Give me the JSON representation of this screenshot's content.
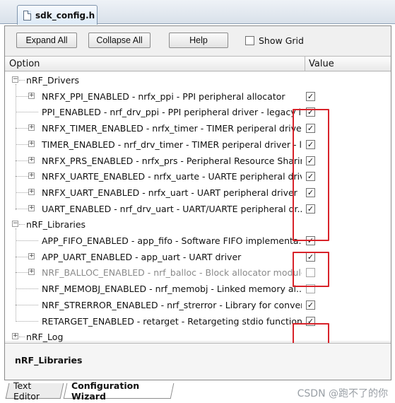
{
  "file_tab": {
    "label": "sdk_config.h"
  },
  "toolbar": {
    "expand_all": "Expand All",
    "collapse_all": "Collapse All",
    "help": "Help",
    "show_grid": "Show Grid",
    "show_grid_checked": false
  },
  "columns": {
    "option": "Option",
    "value": "Value"
  },
  "tree": {
    "groups": [
      {
        "label": "nRF_Drivers",
        "expanded": true,
        "items": [
          {
            "label": "NRFX_PPI_ENABLED - nrfx_ppi - PPI peripheral allocator",
            "has_children": true,
            "checked": true
          },
          {
            "label": "PPI_ENABLED  - nrf_drv_ppi - PPI peripheral driver - legacy l...",
            "has_children": false,
            "checked": true
          },
          {
            "label": "NRFX_TIMER_ENABLED - nrfx_timer - TIMER periperal driver",
            "has_children": true,
            "checked": true
          },
          {
            "label": "TIMER_ENABLED - nrf_drv_timer - TIMER periperal driver - l...",
            "has_children": true,
            "checked": true
          },
          {
            "label": "NRFX_PRS_ENABLED - nrfx_prs - Peripheral Resource Sharin...",
            "has_children": true,
            "checked": true
          },
          {
            "label": "NRFX_UARTE_ENABLED - nrfx_uarte - UARTE peripheral driver",
            "has_children": true,
            "checked": true
          },
          {
            "label": "NRFX_UART_ENABLED - nrfx_uart - UART peripheral driver",
            "has_children": true,
            "checked": true
          },
          {
            "label": "UART_ENABLED - nrf_drv_uart - UART/UARTE peripheral dr...",
            "has_children": true,
            "checked": true
          }
        ]
      },
      {
        "label": "nRF_Libraries",
        "expanded": true,
        "items": [
          {
            "label": "APP_FIFO_ENABLED - app_fifo - Software FIFO implementa...",
            "has_children": false,
            "checked": true
          },
          {
            "label": "APP_UART_ENABLED - app_uart - UART driver",
            "has_children": true,
            "checked": true
          },
          {
            "label": "NRF_BALLOC_ENABLED - nrf_balloc - Block allocator module",
            "has_children": true,
            "checked": false
          },
          {
            "label": "NRF_MEMOBJ_ENABLED  - nrf_memobj - Linked memory al...",
            "has_children": false,
            "checked": false
          },
          {
            "label": "NRF_STRERROR_ENABLED  - nrf_strerror - Library for conver...",
            "has_children": false,
            "checked": true
          },
          {
            "label": "RETARGET_ENABLED  - retarget - Retargeting stdio functions",
            "has_children": false,
            "checked": true
          }
        ]
      },
      {
        "label": "nRF_Log",
        "expanded": false,
        "items": []
      }
    ]
  },
  "description": {
    "title": "nRF_Libraries"
  },
  "bottom_tabs": [
    {
      "label": "Text Editor",
      "active": false
    },
    {
      "label": "Configuration Wizard",
      "active": true
    }
  ],
  "watermark": "CSDN @跑不了的你",
  "colors": {
    "highlight_box": "#d8232a",
    "tab_border": "#7f95ad"
  }
}
